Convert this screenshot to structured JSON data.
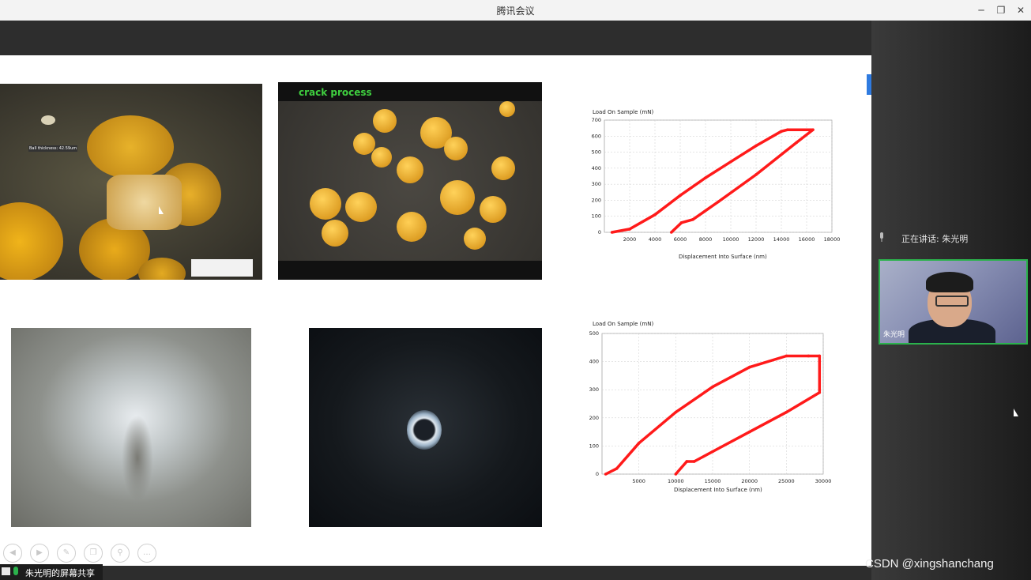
{
  "window": {
    "title": "腾讯会议"
  },
  "slide": {
    "photo2_caption": "crack process",
    "photo1_annotation": "Ball thickness: 42.59um",
    "chart_top": {
      "ylabel": "Load On Sample (mN)",
      "xlabel": "Displacement Into Surface (nm)",
      "yticks": [
        "0",
        "100",
        "200",
        "300",
        "400",
        "500",
        "600",
        "700"
      ],
      "xticks": [
        "2000",
        "4000",
        "6000",
        "8000",
        "10000",
        "12000",
        "14000",
        "16000",
        "18000"
      ]
    },
    "chart_bottom": {
      "ylabel": "Load On Sample (mN)",
      "xlabel": "Displacement Into Surface (nm)",
      "yticks": [
        "0",
        "100",
        "200",
        "300",
        "400",
        "500"
      ],
      "xticks": [
        "5000",
        "10000",
        "15000",
        "20000",
        "25000",
        "30000"
      ]
    }
  },
  "chart_data": [
    {
      "type": "line",
      "ylabel": "Load On Sample (mN)",
      "xlabel": "Displacement Into Surface (nm)",
      "xlim": [
        0,
        18000
      ],
      "ylim": [
        0,
        700
      ],
      "series": [
        {
          "x": [
            600,
            2000,
            4000,
            6000,
            8000,
            10000,
            12000,
            14000,
            14500,
            16500,
            15200,
            12000,
            9000,
            7000,
            6100,
            5300
          ],
          "y": [
            0,
            20,
            110,
            230,
            340,
            440,
            540,
            630,
            640,
            640,
            560,
            360,
            190,
            80,
            60,
            0
          ]
        }
      ],
      "color": "#ff1a1a"
    },
    {
      "type": "line",
      "ylabel": "Load On Sample (mN)",
      "xlabel": "Displacement Into Surface (nm)",
      "xlim": [
        0,
        30000
      ],
      "ylim": [
        0,
        500
      ],
      "series": [
        {
          "x": [
            500,
            2000,
            5000,
            10000,
            15000,
            20000,
            25000,
            28000,
            29500,
            29500,
            25000,
            20000,
            15000,
            12500,
            11500,
            10000
          ],
          "y": [
            0,
            20,
            110,
            220,
            310,
            380,
            420,
            420,
            420,
            290,
            220,
            150,
            80,
            45,
            45,
            0
          ]
        }
      ],
      "color": "#ff1a1a"
    }
  ],
  "sidebar": {
    "speaking_label": "正在讲话: 朱光明",
    "participant_name": "朱光明"
  },
  "bottom_bar": {
    "share_label": "朱光明的屏幕共享"
  },
  "watermark": "CSDN @xingshanchang",
  "toolbar_icons": [
    "back-icon",
    "forward-icon",
    "pen-icon",
    "copy-icon",
    "zoom-icon",
    "more-icon"
  ]
}
